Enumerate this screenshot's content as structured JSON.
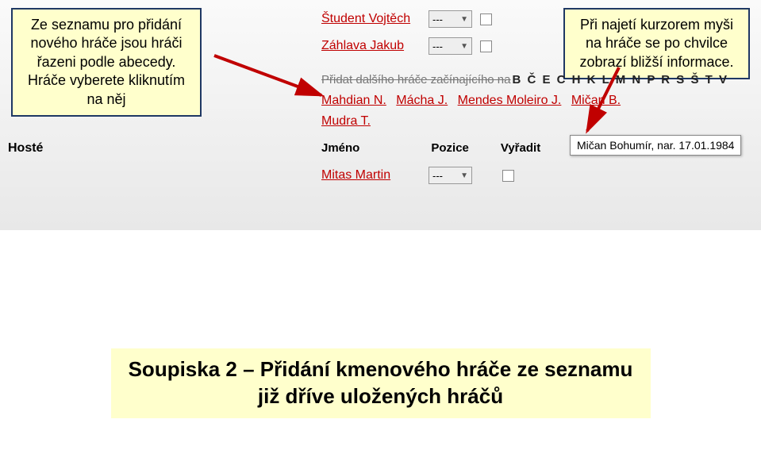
{
  "callouts": {
    "left_line1": "Ze seznamu pro přidání",
    "left_line2": "nového hráče jsou hráči",
    "left_line3": "řazeni podle abecedy.",
    "left_line4": "Hráče vyberete kliknutím",
    "left_line5": "na něj",
    "right_line1": "Při najetí kurzorem myši",
    "right_line2": "na hráče se po chvilce",
    "right_line3": "zobrazí bližší informace."
  },
  "players": {
    "row1": "Študent Vojtěch",
    "row2": "Záhlava Jakub"
  },
  "select_placeholder": "---",
  "alpha": {
    "prefix": "Přidat dalšího hráče začínajícího na",
    "letters": "B Č E C H K L M N P R S Š T V"
  },
  "candidates": {
    "c1": "Mahdian N.",
    "c2": "Mácha J.",
    "c3": "Mendes Moleiro J.",
    "c4": "Mičan B.",
    "c5": "Mudra T."
  },
  "host_label": "Hosté",
  "headers": {
    "h1": "Jméno",
    "h2": "Pozice",
    "h3": "Vyřadit"
  },
  "guest": {
    "name": "Mitas Martin"
  },
  "tooltip": "Mičan Bohumír, nar. 17.01.1984",
  "title": {
    "line1": "Soupiska 2 – Přidání kmenového hráče ze seznamu",
    "line2": "již dříve uložených hráčů"
  }
}
